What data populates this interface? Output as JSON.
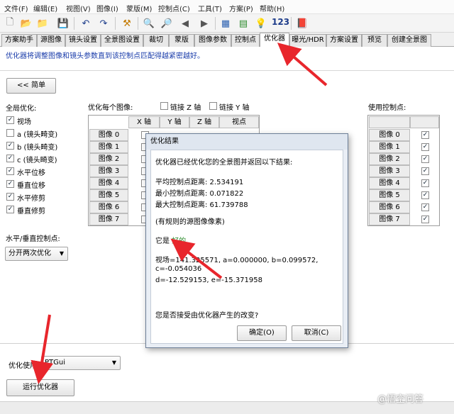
{
  "menu": [
    "文件(F)",
    "编辑(E)",
    "视图(V)",
    "图像(I)",
    "蒙版(M)",
    "控制点(C)",
    "工具(T)",
    "方案(P)",
    "帮助(H)"
  ],
  "toolbar": {
    "number_label": "123"
  },
  "tabs": [
    "方案助手",
    "源图像",
    "镜头设置",
    "全景图设置",
    "裁切",
    "蒙版",
    "图像参数",
    "控制点",
    "优化器",
    "曝光/HDR",
    "方案设置",
    "预览",
    "创建全景图"
  ],
  "hint": "优化器将调整图像和镜头参数直到该控制点匹配得越紧密越好。",
  "simple_button": "<< 简单",
  "global_opt_label": "全局优化:",
  "global_opts": [
    {
      "label": "视场",
      "checked": true
    },
    {
      "label": "a (镜头畸变)",
      "checked": false
    },
    {
      "label": "b (镜头畸变)",
      "checked": true
    },
    {
      "label": "c (镜头畸变)",
      "checked": true
    },
    {
      "label": "水平位移",
      "checked": true
    },
    {
      "label": "垂直位移",
      "checked": true
    },
    {
      "label": "水平修剪",
      "checked": true
    },
    {
      "label": "垂直修剪",
      "checked": true
    }
  ],
  "hv_label": "水平/垂直控制点:",
  "hv_select": "分开两次优化",
  "per_image_label": "优化每个图像:",
  "link_z": "链接 Z 轴",
  "link_y": "链接 Y 轴",
  "columns": [
    "X 轴",
    "Y 轴",
    "Z 轴",
    "视点"
  ],
  "images": [
    "图像 0",
    "图像 1",
    "图像 2",
    "图像 3",
    "图像 4",
    "图像 5",
    "图像 6",
    "图像 7"
  ],
  "use_cp_label": "使用控制点:",
  "optimizer_use_label": "优化使用:",
  "optimizer_select": "PTGui",
  "run_button": "运行优化器",
  "dialog": {
    "title": "优化结果",
    "intro": "优化器已经优化您的全景图并返回以下结果:",
    "avg": "平均控制点距离: 2.534191",
    "min": "最小控制点距离: 0.071822",
    "max": "最大控制点距离: 61.739788",
    "rule": "(有规则的源图像像素)",
    "verdict_prefix": "它是 ",
    "verdict": "好的.",
    "params1": "视场=141.325571, a=0.000000, b=0.099572,",
    "params2": "c=-0.054036",
    "params3": "d=-12.529153, e=-15.371958",
    "question": "您是否接受由优化器产生的改变?",
    "ok": "确定(O)",
    "cancel": "取消(C)"
  },
  "watermark": "@悟空问答",
  "colors": {
    "hint_text": "#1a3caa",
    "good_text": "#2a8a2a",
    "arrow": "#e8262c"
  }
}
